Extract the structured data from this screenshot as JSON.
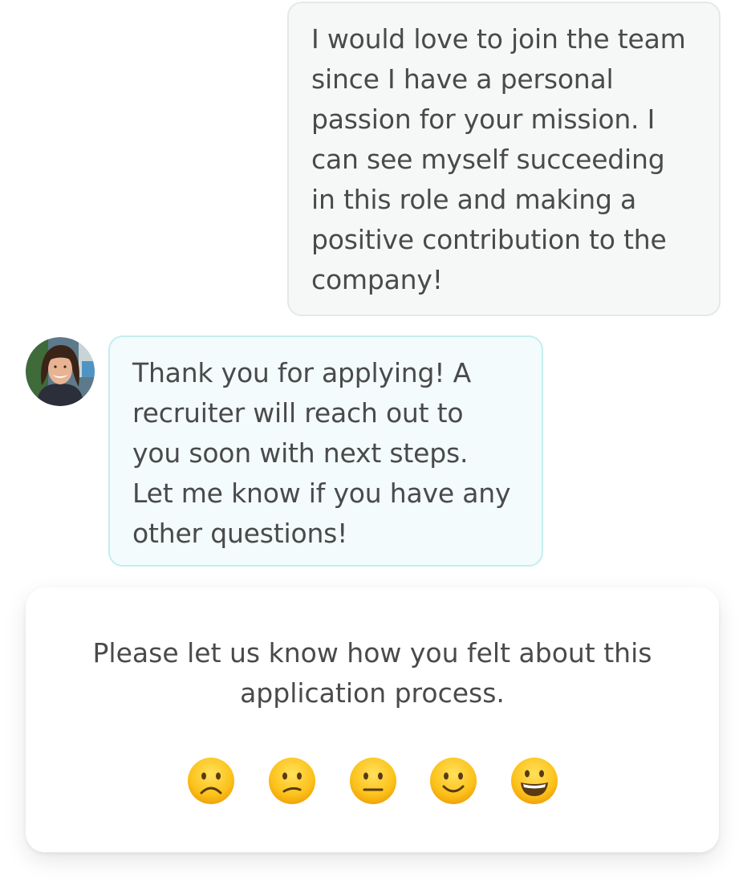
{
  "conversation": {
    "user_message": {
      "lines": [
        "I would love to join the team",
        "since I have a personal",
        "passion for your mission. I",
        "can see myself succeeding",
        "in this role and making a",
        "positive contribution to the",
        "company!"
      ]
    },
    "bot_message": {
      "avatar_icon": "recruiter-avatar",
      "lines": [
        "Thank you for applying! A",
        "recruiter will reach out to",
        "you soon with next steps.",
        "Let me know if you have any",
        "other questions!"
      ]
    }
  },
  "feedback": {
    "prompt_lines": [
      "Please let us know how you felt about this",
      "application process."
    ],
    "ratings": [
      {
        "icon": "frowning-face-icon",
        "value": 1
      },
      {
        "icon": "confused-face-icon",
        "value": 2
      },
      {
        "icon": "neutral-face-icon",
        "value": 3
      },
      {
        "icon": "slightly-smiling-face-icon",
        "value": 4
      },
      {
        "icon": "grinning-face-icon",
        "value": 5
      }
    ]
  },
  "colors": {
    "user_bubble_bg": "#f6f7f7",
    "bot_bubble_bg": "#f3fbfc",
    "bot_bubble_border": "#c3eef0",
    "text": "#4a4a4a"
  }
}
